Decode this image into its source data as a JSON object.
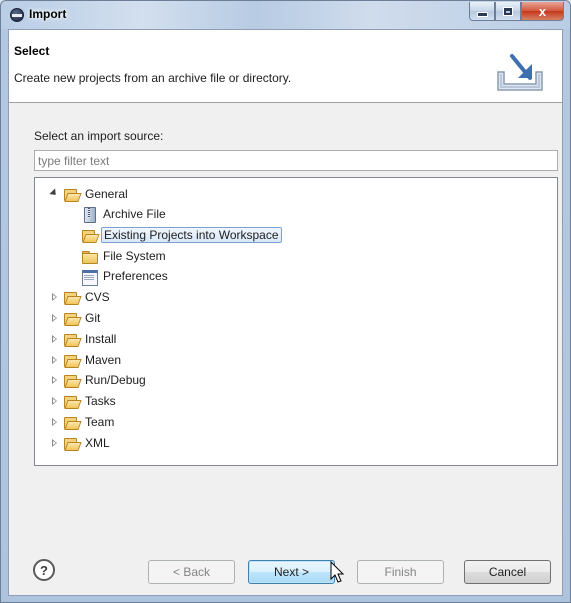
{
  "window": {
    "title": "Import",
    "close_glyph": "x"
  },
  "header": {
    "title": "Select",
    "description": "Create new projects from an archive file or directory."
  },
  "source": {
    "label": "Select an import source:",
    "filter_placeholder": "type filter text"
  },
  "tree": {
    "general": {
      "label": "General",
      "expanded": true
    },
    "children": [
      {
        "label": "Archive File",
        "icon": "archive-icon"
      },
      {
        "label": "Existing Projects into Workspace",
        "icon": "folder-open-icon",
        "selected": true
      },
      {
        "label": "File System",
        "icon": "folder-icon"
      },
      {
        "label": "Preferences",
        "icon": "preferences-icon"
      }
    ],
    "categories": [
      {
        "label": "CVS"
      },
      {
        "label": "Git"
      },
      {
        "label": "Install"
      },
      {
        "label": "Maven"
      },
      {
        "label": "Run/Debug"
      },
      {
        "label": "Tasks"
      },
      {
        "label": "Team"
      },
      {
        "label": "XML"
      }
    ]
  },
  "buttons": {
    "help": "?",
    "back": "< Back",
    "next": "Next >",
    "finish": "Finish",
    "cancel": "Cancel"
  },
  "colors": {
    "selection_border": "#7da2ce",
    "default_button_border": "#3c7fb1"
  }
}
